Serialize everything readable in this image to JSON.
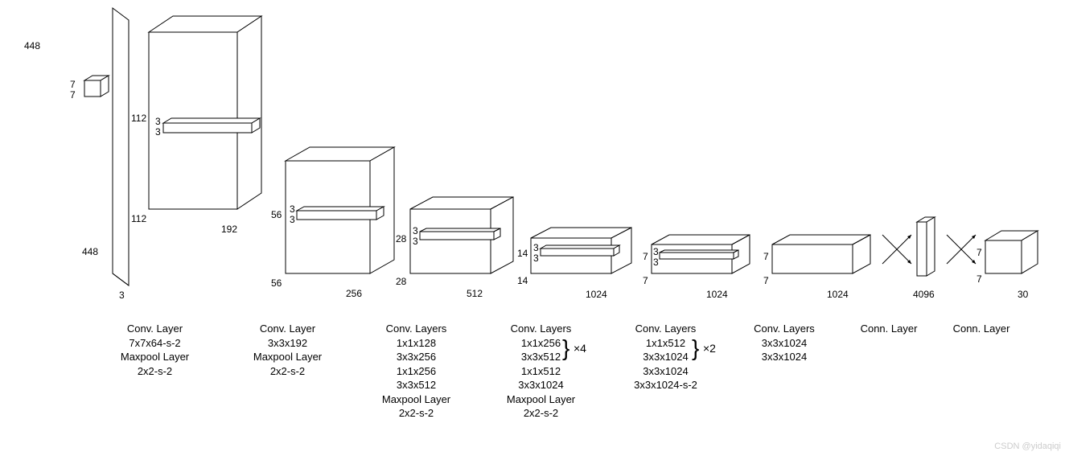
{
  "watermark": "CSDN @yidaqiqi",
  "blocks": {
    "b1": {
      "top_h": "448",
      "bot_w": "448",
      "depth": "3",
      "filter_h": "7",
      "filter_w": "7"
    },
    "b2": {
      "top_h": "112",
      "bot_w": "112",
      "depth": "192",
      "filter_h": "3",
      "filter_w": "3"
    },
    "b3": {
      "top_h": "56",
      "bot_w": "56",
      "depth": "256",
      "filter_h": "3",
      "filter_w": "3"
    },
    "b4": {
      "top_h": "28",
      "bot_w": "28",
      "depth": "512",
      "filter_h": "3",
      "filter_w": "3"
    },
    "b5": {
      "top_h": "14",
      "bot_w": "14",
      "depth": "1024",
      "filter_h": "3",
      "filter_w": "3"
    },
    "b6": {
      "top_h": "7",
      "bot_w": "7",
      "depth": "1024",
      "filter_h": "3",
      "filter_w": "3"
    },
    "b7": {
      "top_h": "7",
      "bot_w": "7",
      "depth": "1024"
    },
    "b8": {
      "depth": "4096"
    },
    "b9": {
      "top_h": "7",
      "bot_w": "7",
      "depth": "30"
    }
  },
  "captions": {
    "c1": {
      "t": "Conv. Layer",
      "l1": "7x7x64-s-2",
      "l2": "Maxpool Layer",
      "l3": "2x2-s-2"
    },
    "c2": {
      "t": "Conv. Layer",
      "l1": "3x3x192",
      "l2": "Maxpool Layer",
      "l3": "2x2-s-2"
    },
    "c3": {
      "t": "Conv. Layers",
      "l1": "1x1x128",
      "l2": "3x3x256",
      "l3": "1x1x256",
      "l4": "3x3x512",
      "l5": "Maxpool Layer",
      "l6": "2x2-s-2"
    },
    "c4": {
      "t": "Conv. Layers",
      "l1": "1x1x256",
      "l2": "3x3x512",
      "l3": "1x1x512",
      "l4": "3x3x1024",
      "l5": "Maxpool Layer",
      "l6": "2x2-s-2",
      "mult": "×4"
    },
    "c5": {
      "t": "Conv. Layers",
      "l1": "1x1x512",
      "l2": "3x3x1024",
      "l3": "3x3x1024",
      "l4": "3x3x1024-s-2",
      "mult": "×2"
    },
    "c6": {
      "t": "Conv. Layers",
      "l1": "3x3x1024",
      "l2": "3x3x1024"
    },
    "c7": {
      "t": "Conn. Layer"
    },
    "c8": {
      "t": "Conn. Layer"
    }
  }
}
